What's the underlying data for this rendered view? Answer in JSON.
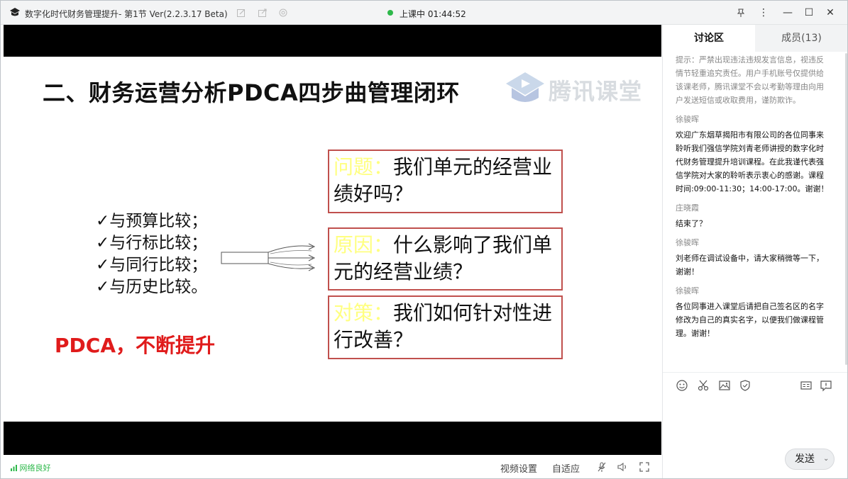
{
  "window": {
    "title": "数字化时代财务管理提升- 第1节 Ver(2.2.3.17 Beta)",
    "live_status": "上课中 01:44:52",
    "live_color": "#2db84a"
  },
  "slide": {
    "title": "二、财务运营分析PDCA四步曲管理闭环",
    "watermark": "腾讯课堂",
    "checklist": [
      "✓与预算比较；",
      "✓与行标比较；",
      "✓与同行比较；",
      "✓与历史比较。"
    ],
    "pdca_slogan": "PDCA，不断提升",
    "boxes": [
      {
        "keyword": "问题：",
        "text": "我们单元的经营业绩好吗？"
      },
      {
        "keyword": "原因：",
        "text": "什么影响了我们单元的经营业绩？"
      },
      {
        "keyword": "对策：",
        "text": "我们如何针对性进行改善？"
      }
    ],
    "accent_red": "#e01b1b",
    "box_border": "#c0504d",
    "keyword_color": "#ffff80"
  },
  "statusbar": {
    "network": "网络良好",
    "video_settings": "视频设置",
    "auto_fit": "自适应"
  },
  "panel": {
    "tabs": [
      "讨论区",
      "成员(13)"
    ],
    "notice": "提示：严禁出现违法违规发言信息，视违反情节轻重追究责任。用户手机账号仅提供给该课老师，腾讯课堂不会以考勤等理由向用户发送短信或收取费用，谨防欺诈。",
    "messages": [
      {
        "name": "徐骏晖",
        "text": "欢迎广东烟草揭阳市有限公司的各位同事来聆听我们强信学院刘青老师讲授的数字化时代财务管理提升培训课程。在此我谨代表强信学院对大家的聆听表示衷心的感谢。课程时间:09:00-11:30；14:00-17:00。谢谢！"
      },
      {
        "name": "庄晓霞",
        "text": "结束了？"
      },
      {
        "name": "徐骏晖",
        "text": "刘老师在调试设备中，请大家稍微等一下，谢谢！"
      },
      {
        "name": "徐骏晖",
        "text": "各位同事进入课堂后请把自己签名区的名字修改为自己的真实名字，以便我们做课程管理。谢谢！"
      }
    ],
    "send_label": "发送"
  }
}
